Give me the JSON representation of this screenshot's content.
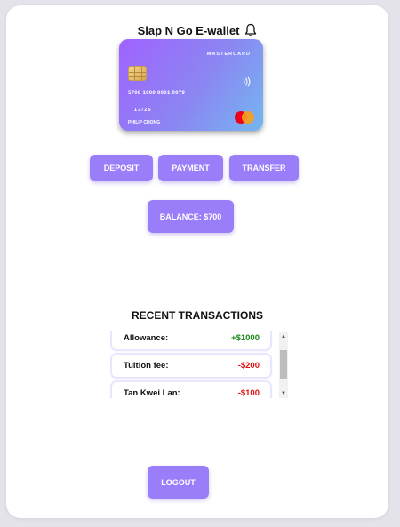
{
  "header": {
    "title": "Slap N Go E-wallet",
    "notification_icon": "bell-icon"
  },
  "card": {
    "brand": "MASTERCARD",
    "number": "5708 1000 0001 0079",
    "expiry": "12/25",
    "holder": "PHILIP CHONG",
    "chip_icon": "chip-icon",
    "contactless_icon": "contactless-icon",
    "network_logo": "mastercard-logo",
    "gradient_colors": [
      "#a062ff",
      "#8b86f2",
      "#74b6f0"
    ]
  },
  "actions": {
    "deposit_label": "DEPOSIT",
    "payment_label": "PAYMENT",
    "transfer_label": "TRANSFER",
    "balance_label": "BALANCE: $700",
    "logout_label": "LOGOUT"
  },
  "transactions": {
    "title": "RECENT TRANSACTIONS",
    "items": [
      {
        "label": "Allowance:",
        "amount": "+$1000",
        "type": "credit"
      },
      {
        "label": "Tuition fee:",
        "amount": "-$200",
        "type": "debit"
      },
      {
        "label": "Tan Kwei Lan:",
        "amount": "-$100",
        "type": "debit"
      }
    ]
  },
  "colors": {
    "accent": "#9a7ef9",
    "credit": "#1b8a1b",
    "debit": "#e01414",
    "background": "#e4e3ea"
  }
}
